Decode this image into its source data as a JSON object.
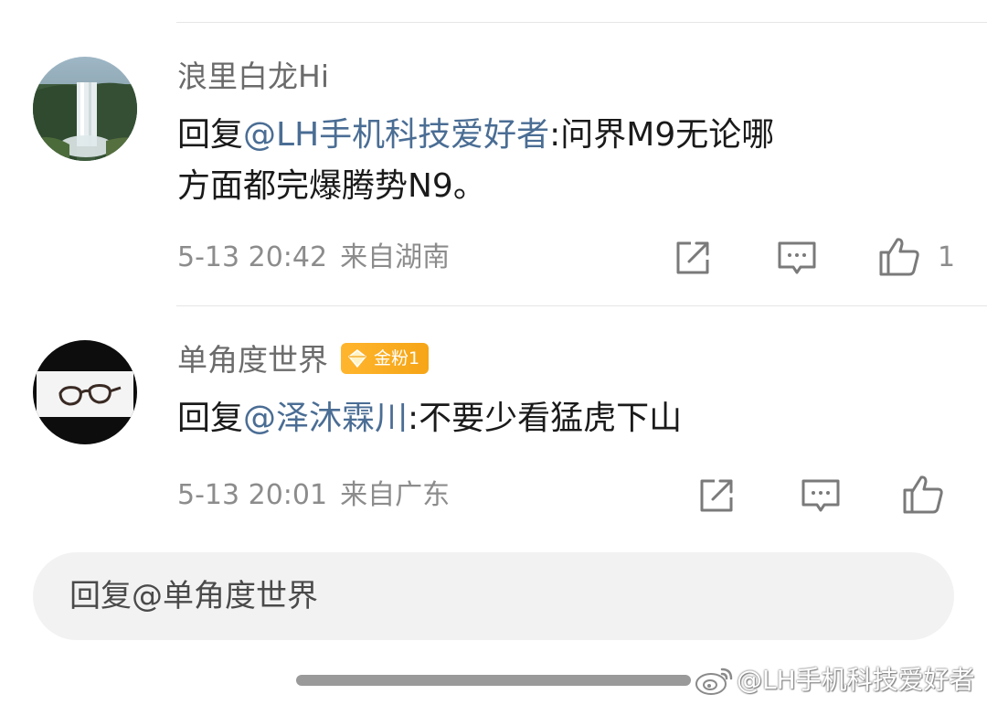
{
  "comments": [
    {
      "username": "浪里白龙Hi",
      "reply_prefix": "回复",
      "mention": "@LH手机科技爱好者",
      "text_line1": ":问界M9无论哪",
      "text_line2": "方面都完爆腾势N9。",
      "timestamp": "5-13 20:42",
      "location": "来自湖南",
      "like_count": "1",
      "avatar_icon": "waterfall-avatar"
    },
    {
      "username": "单角度世界",
      "badge": "金粉1",
      "reply_prefix": "回复",
      "mention": "@泽沐霖川",
      "text": ":不要少看猛虎下山",
      "timestamp": "5-13 20:01",
      "location": "来自广东",
      "avatar_icon": "glasses-avatar"
    }
  ],
  "reply_input": {
    "placeholder": "回复@单角度世界"
  },
  "watermark": {
    "text": "@LH手机科技爱好者",
    "icon": "weibo-logo-icon"
  },
  "colors": {
    "mention": "#4a6d94",
    "badge": "#f5a516",
    "meta": "#8c8c8c"
  }
}
